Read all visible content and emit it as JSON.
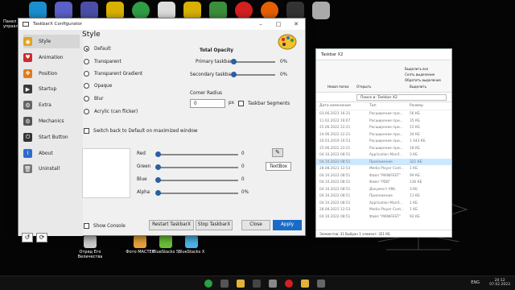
{
  "desktop": {
    "left_label": "Панел управле",
    "bottom_icons": [
      {
        "label": "Отряд Его Величества"
      },
      {
        "label": "Фото МАСТЕР"
      },
      {
        "label": "BlueStacks 5"
      },
      {
        "label": "BlueStacks X"
      }
    ]
  },
  "explorer": {
    "title": "Taskbar X2",
    "search_placeholder": "Поиск в: Taskbar X2",
    "ribbon_items": [
      "Новая папка",
      "Открыть",
      "Выделить все",
      "Снять выделение",
      "Обратить выделение",
      "Выделить"
    ],
    "col_date": "Дата изменения",
    "col_type": "Тип",
    "col_size": "Размер",
    "rows": [
      {
        "date": "03.06.2021 16:31",
        "type": "Расширение при...",
        "size": "56 КБ"
      },
      {
        "date": "11.02.2022 16:07",
        "type": "Расширение при...",
        "size": "35 КБ"
      },
      {
        "date": "25.06.2022 22:21",
        "type": "Расширение при...",
        "size": "15 КБ"
      },
      {
        "date": "24.06.2022 22:21",
        "type": "Расширение при...",
        "size": "34 КБ"
      },
      {
        "date": "20.03.2019 16:53",
        "type": "Расширение при...",
        "size": "1 443 КБ"
      },
      {
        "date": "25.06.2022 22:21",
        "type": "Расширение при...",
        "size": "18 КБ"
      },
      {
        "date": "04.10.2022 08:51",
        "type": "Application Manif...",
        "size": "3 КБ"
      },
      {
        "date": "04.10.2022 08:51",
        "type": "Приложение",
        "size": "321 КБ",
        "selected": true
      },
      {
        "date": "28.08.2021 12:53",
        "type": "Media Player Cont...",
        "size": "1 КБ"
      },
      {
        "date": "04.10.2022 08:51",
        "type": "Файл \"MANIFEST\"",
        "size": "99 КБ"
      },
      {
        "date": "04.10.2022 08:51",
        "type": "Файл \"PDB\"",
        "size": "136 КБ"
      },
      {
        "date": "04.10.2022 08:51",
        "type": "Документ XML",
        "size": "3 КБ"
      },
      {
        "date": "04.10.2022 08:51",
        "type": "Приложение",
        "size": "11 КБ"
      },
      {
        "date": "04.10.2022 08:51",
        "type": "Application Manif...",
        "size": "1 КБ"
      },
      {
        "date": "28.08.2021 12:53",
        "type": "Media Player Cont...",
        "size": "1 КБ"
      },
      {
        "date": "04.10.2022 08:51",
        "type": "Файл \"MANIFEST\"",
        "size": "92 КБ"
      }
    ],
    "status": "Элементов: 31   Выбран 1 элемент: 321 КБ"
  },
  "config": {
    "title": "TaskbarX Configurator",
    "nav": [
      {
        "label": "Style",
        "icon": "palette-icon",
        "color": "#e6a21d"
      },
      {
        "label": "Animation",
        "icon": "heart-icon",
        "color": "#d02a2a"
      },
      {
        "label": "Position",
        "icon": "position-icon",
        "color": "#e07a20"
      },
      {
        "label": "Startup",
        "icon": "startup-icon",
        "color": "#3a3a3a"
      },
      {
        "label": "Extra",
        "icon": "gear-icon",
        "color": "#666666"
      },
      {
        "label": "Mechanics",
        "icon": "mechanics-icon",
        "color": "#555555"
      },
      {
        "label": "Start Button",
        "icon": "power-icon",
        "color": "#333333"
      },
      {
        "label": "About",
        "icon": "info-icon",
        "color": "#2d6bd0"
      },
      {
        "label": "Uninstall",
        "icon": "trash-icon",
        "color": "#777777"
      }
    ],
    "heading": "Style",
    "styles": [
      "Default",
      "Transparent",
      "Transparent Gradient",
      "Opaque",
      "Blur",
      "Acrylic (can flicker)"
    ],
    "selected_style": "Default",
    "total_opacity_label": "Total Opacity",
    "primary_taskbar_label": "Primary taskbar",
    "primary_value": "0%",
    "secondary_taskbar_label": "Secondary taskbar",
    "secondary_value": "0%",
    "corner_radius_label": "Corner Radius",
    "corner_radius_value": "0",
    "corner_radius_unit": "px",
    "taskbar_segments_label": "Taskbar Segments",
    "switch_back_label": "Switch back to Default on maximized window",
    "color": {
      "red_label": "Red",
      "red_value": "0",
      "green_label": "Green",
      "green_value": "0",
      "blue_label": "Blue",
      "blue_value": "0",
      "alpha_label": "Alpha",
      "alpha_value": "0%"
    },
    "text_box_value": "TextBox",
    "show_console_label": "Show Console",
    "buttons": {
      "restart": "Restart TaskbarX",
      "stop": "Stop TaskbarX",
      "close": "Close",
      "apply": "Apply"
    }
  },
  "taskbar": {
    "lang": "ENG",
    "time": "20:12",
    "date": "07.02.2023"
  }
}
